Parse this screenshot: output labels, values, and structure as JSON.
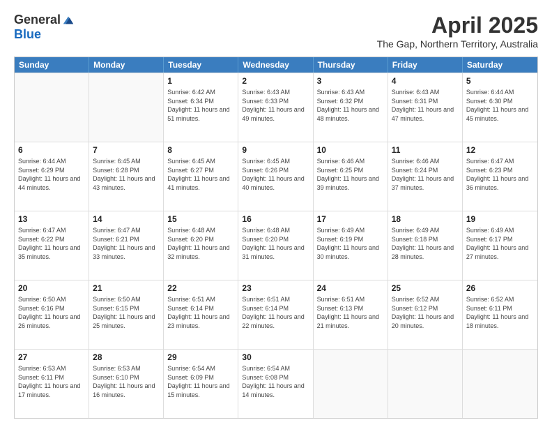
{
  "header": {
    "logo_general": "General",
    "logo_blue": "Blue",
    "month_title": "April 2025",
    "location": "The Gap, Northern Territory, Australia"
  },
  "calendar": {
    "days": [
      "Sunday",
      "Monday",
      "Tuesday",
      "Wednesday",
      "Thursday",
      "Friday",
      "Saturday"
    ],
    "rows": [
      [
        {
          "day": "",
          "empty": true
        },
        {
          "day": "",
          "empty": true
        },
        {
          "day": "1",
          "sunrise": "Sunrise: 6:42 AM",
          "sunset": "Sunset: 6:34 PM",
          "daylight": "Daylight: 11 hours and 51 minutes."
        },
        {
          "day": "2",
          "sunrise": "Sunrise: 6:43 AM",
          "sunset": "Sunset: 6:33 PM",
          "daylight": "Daylight: 11 hours and 49 minutes."
        },
        {
          "day": "3",
          "sunrise": "Sunrise: 6:43 AM",
          "sunset": "Sunset: 6:32 PM",
          "daylight": "Daylight: 11 hours and 48 minutes."
        },
        {
          "day": "4",
          "sunrise": "Sunrise: 6:43 AM",
          "sunset": "Sunset: 6:31 PM",
          "daylight": "Daylight: 11 hours and 47 minutes."
        },
        {
          "day": "5",
          "sunrise": "Sunrise: 6:44 AM",
          "sunset": "Sunset: 6:30 PM",
          "daylight": "Daylight: 11 hours and 45 minutes."
        }
      ],
      [
        {
          "day": "6",
          "sunrise": "Sunrise: 6:44 AM",
          "sunset": "Sunset: 6:29 PM",
          "daylight": "Daylight: 11 hours and 44 minutes."
        },
        {
          "day": "7",
          "sunrise": "Sunrise: 6:45 AM",
          "sunset": "Sunset: 6:28 PM",
          "daylight": "Daylight: 11 hours and 43 minutes."
        },
        {
          "day": "8",
          "sunrise": "Sunrise: 6:45 AM",
          "sunset": "Sunset: 6:27 PM",
          "daylight": "Daylight: 11 hours and 41 minutes."
        },
        {
          "day": "9",
          "sunrise": "Sunrise: 6:45 AM",
          "sunset": "Sunset: 6:26 PM",
          "daylight": "Daylight: 11 hours and 40 minutes."
        },
        {
          "day": "10",
          "sunrise": "Sunrise: 6:46 AM",
          "sunset": "Sunset: 6:25 PM",
          "daylight": "Daylight: 11 hours and 39 minutes."
        },
        {
          "day": "11",
          "sunrise": "Sunrise: 6:46 AM",
          "sunset": "Sunset: 6:24 PM",
          "daylight": "Daylight: 11 hours and 37 minutes."
        },
        {
          "day": "12",
          "sunrise": "Sunrise: 6:47 AM",
          "sunset": "Sunset: 6:23 PM",
          "daylight": "Daylight: 11 hours and 36 minutes."
        }
      ],
      [
        {
          "day": "13",
          "sunrise": "Sunrise: 6:47 AM",
          "sunset": "Sunset: 6:22 PM",
          "daylight": "Daylight: 11 hours and 35 minutes."
        },
        {
          "day": "14",
          "sunrise": "Sunrise: 6:47 AM",
          "sunset": "Sunset: 6:21 PM",
          "daylight": "Daylight: 11 hours and 33 minutes."
        },
        {
          "day": "15",
          "sunrise": "Sunrise: 6:48 AM",
          "sunset": "Sunset: 6:20 PM",
          "daylight": "Daylight: 11 hours and 32 minutes."
        },
        {
          "day": "16",
          "sunrise": "Sunrise: 6:48 AM",
          "sunset": "Sunset: 6:20 PM",
          "daylight": "Daylight: 11 hours and 31 minutes."
        },
        {
          "day": "17",
          "sunrise": "Sunrise: 6:49 AM",
          "sunset": "Sunset: 6:19 PM",
          "daylight": "Daylight: 11 hours and 30 minutes."
        },
        {
          "day": "18",
          "sunrise": "Sunrise: 6:49 AM",
          "sunset": "Sunset: 6:18 PM",
          "daylight": "Daylight: 11 hours and 28 minutes."
        },
        {
          "day": "19",
          "sunrise": "Sunrise: 6:49 AM",
          "sunset": "Sunset: 6:17 PM",
          "daylight": "Daylight: 11 hours and 27 minutes."
        }
      ],
      [
        {
          "day": "20",
          "sunrise": "Sunrise: 6:50 AM",
          "sunset": "Sunset: 6:16 PM",
          "daylight": "Daylight: 11 hours and 26 minutes."
        },
        {
          "day": "21",
          "sunrise": "Sunrise: 6:50 AM",
          "sunset": "Sunset: 6:15 PM",
          "daylight": "Daylight: 11 hours and 25 minutes."
        },
        {
          "day": "22",
          "sunrise": "Sunrise: 6:51 AM",
          "sunset": "Sunset: 6:14 PM",
          "daylight": "Daylight: 11 hours and 23 minutes."
        },
        {
          "day": "23",
          "sunrise": "Sunrise: 6:51 AM",
          "sunset": "Sunset: 6:14 PM",
          "daylight": "Daylight: 11 hours and 22 minutes."
        },
        {
          "day": "24",
          "sunrise": "Sunrise: 6:51 AM",
          "sunset": "Sunset: 6:13 PM",
          "daylight": "Daylight: 11 hours and 21 minutes."
        },
        {
          "day": "25",
          "sunrise": "Sunrise: 6:52 AM",
          "sunset": "Sunset: 6:12 PM",
          "daylight": "Daylight: 11 hours and 20 minutes."
        },
        {
          "day": "26",
          "sunrise": "Sunrise: 6:52 AM",
          "sunset": "Sunset: 6:11 PM",
          "daylight": "Daylight: 11 hours and 18 minutes."
        }
      ],
      [
        {
          "day": "27",
          "sunrise": "Sunrise: 6:53 AM",
          "sunset": "Sunset: 6:11 PM",
          "daylight": "Daylight: 11 hours and 17 minutes."
        },
        {
          "day": "28",
          "sunrise": "Sunrise: 6:53 AM",
          "sunset": "Sunset: 6:10 PM",
          "daylight": "Daylight: 11 hours and 16 minutes."
        },
        {
          "day": "29",
          "sunrise": "Sunrise: 6:54 AM",
          "sunset": "Sunset: 6:09 PM",
          "daylight": "Daylight: 11 hours and 15 minutes."
        },
        {
          "day": "30",
          "sunrise": "Sunrise: 6:54 AM",
          "sunset": "Sunset: 6:08 PM",
          "daylight": "Daylight: 11 hours and 14 minutes."
        },
        {
          "day": "",
          "empty": true
        },
        {
          "day": "",
          "empty": true
        },
        {
          "day": "",
          "empty": true
        }
      ]
    ]
  }
}
